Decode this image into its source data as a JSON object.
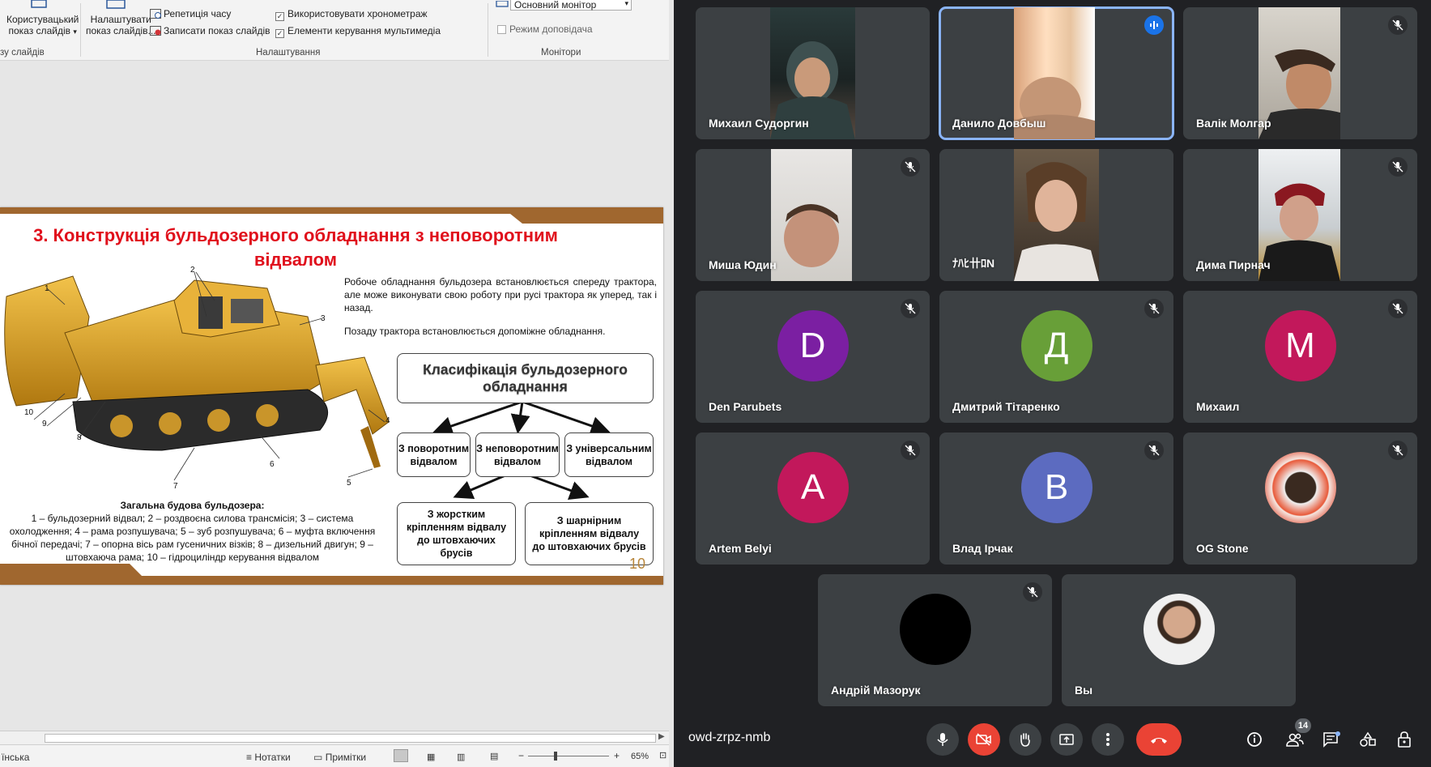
{
  "ribbon": {
    "custom_show_l1": "Користувацький",
    "custom_show_l2": "показ слайдів",
    "setup_l1": "Налаштувати",
    "setup_l2": "показ слайдів...",
    "rehearse": "Репетиція часу",
    "record": "Записати показ слайдів",
    "use_timings": "Використовувати хронометраж",
    "media_controls": "Елементи керування мультимедіа",
    "monitor_value": "Основний монітор",
    "presenter_view": "Режим доповідача",
    "group_start": "зу слайдів",
    "group_setup": "Налаштування",
    "group_monitors": "Монітори"
  },
  "slide": {
    "title": "3. Конструкція бульдозерного обладнання з неповоротним відвалом",
    "para1": "Робоче обладнання бульдозера встановлюється спереду трактора, але може виконувати свою роботу при русі трактора як уперед, так і назад.",
    "para2": "Позаду трактора встановлюється допоміжне обладнання.",
    "box_main": "Класифікація бульдозерного обладнання",
    "box_a": "З поворотним відвалом",
    "box_b": "З неповоротним відвалом",
    "box_c": "З універсальним відвалом",
    "box_d": "З жорстким кріпленням відвалу до штовхаючих брусів",
    "box_e": "З шарнірним кріпленням відвалу до штовхаючих брусів",
    "caption_title": "Загальна будова бульдозера:",
    "caption_body": "1 – бульдозерний відвал; 2 – роздвоєна силова трансмісія; 3 – система охолодження; 4 – рама розпушувача; 5 – зуб розпушувача; 6 – муфта включення бічної передачі; 7 – опорна вісь рам гусеничних візків; 8 – дизельний двигун; 9 – штовхаюча рама; 10 – гідроциліндр керування відвалом",
    "page_number": "10",
    "callouts": [
      "1",
      "2",
      "3",
      "4",
      "5",
      "6",
      "7",
      "8",
      "9",
      "10"
    ]
  },
  "status": {
    "language": "їнська",
    "notes": "Нотатки",
    "comments": "Примітки",
    "zoom": "65%"
  },
  "meet": {
    "tiles": [
      {
        "name": "Михаил Судоргин",
        "muted": false,
        "video": true
      },
      {
        "name": "Данило Довбыш",
        "muted": false,
        "video": true,
        "speaking": true
      },
      {
        "name": "Валік Молгар",
        "muted": true,
        "video": true
      },
      {
        "name": "Миша Юдин",
        "muted": true,
        "video": true
      },
      {
        "name": "ﾅﾊﾋ卄ﾛN",
        "muted": false,
        "video": true
      },
      {
        "name": "Дима Пирнач",
        "muted": true,
        "video": true
      },
      {
        "name": "Den Parubets",
        "muted": true,
        "initial": "D",
        "color": "#7b1fa2"
      },
      {
        "name": "Дмитрий Тітаренко",
        "muted": true,
        "initial": "Д",
        "color": "#689f38"
      },
      {
        "name": "Михаил",
        "muted": true,
        "initial": "M",
        "color": "#c2185b"
      },
      {
        "name": "Artem Belyi",
        "muted": true,
        "initial": "A",
        "color": "#c2185b"
      },
      {
        "name": "Влад Ірчак",
        "muted": true,
        "initial": "B",
        "color": "#5c6bc0"
      },
      {
        "name": "OG Stone",
        "muted": true,
        "photo": true
      },
      {
        "name": "Андрій Мазорук",
        "muted": true,
        "initial": "",
        "color": "#000000"
      },
      {
        "name": "Вы",
        "muted": false,
        "photo": true
      }
    ],
    "meeting_code": "owd-zrpz-nmb",
    "participants_count": "14",
    "colors": {
      "end_call": "#ea4335",
      "cam_off": "#ea4335",
      "speaking": "#1a73e8"
    }
  }
}
